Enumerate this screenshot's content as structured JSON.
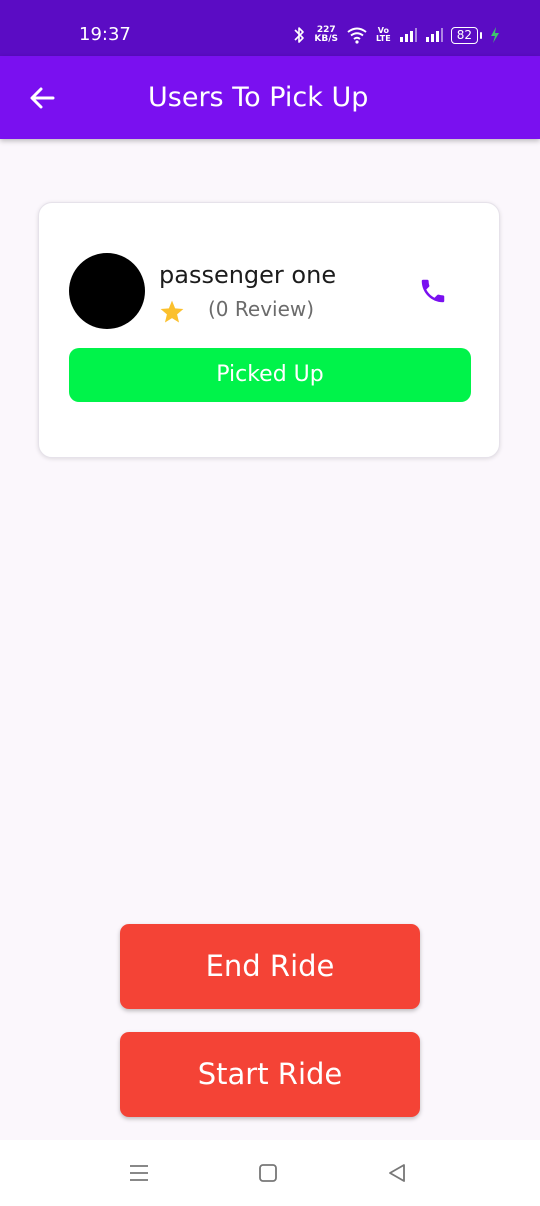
{
  "status_bar": {
    "time": "19:37",
    "net_speed_value": "227",
    "net_speed_unit": "KB/S",
    "volte_top": "Vo",
    "volte_bottom": "LTE",
    "battery_level": "82",
    "icons": [
      "bluetooth-icon",
      "wifi-icon",
      "signal-icon",
      "battery-icon",
      "charging-bolt-icon"
    ]
  },
  "app_bar": {
    "title": "Users To Pick Up",
    "back_icon": "arrow-left-icon"
  },
  "passenger_card": {
    "name": "passenger one",
    "review_text": "(0 Review)",
    "rating_icon": "star-icon",
    "call_icon": "phone-icon",
    "picked_up_label": "Picked Up"
  },
  "actions": {
    "end_ride_label": "End Ride",
    "start_ride_label": "Start Ride"
  },
  "nav_bar": {
    "icons": [
      "menu-icon",
      "home-icon",
      "back-icon"
    ]
  },
  "colors": {
    "status_bar": "#5b0cc4",
    "app_bar": "#7a10f0",
    "picked_up": "#00f34a",
    "ride_buttons": "#f44336",
    "star": "#fbc02d",
    "phone": "#7a10f0",
    "background": "#fbf7fc"
  }
}
